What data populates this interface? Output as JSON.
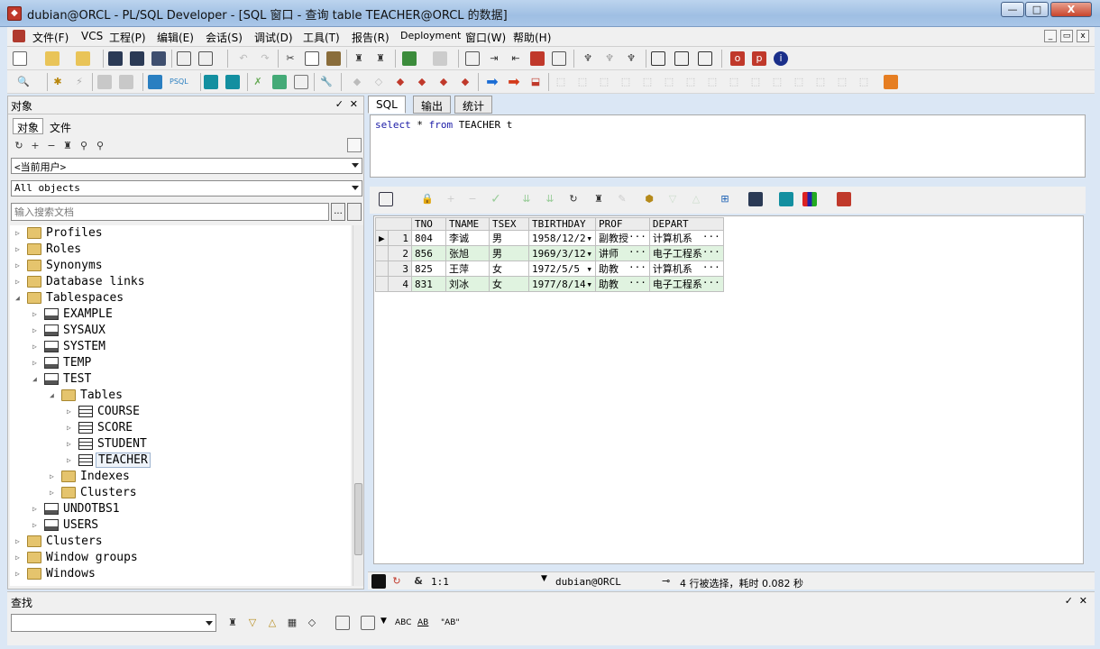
{
  "window": {
    "title": "dubian@ORCL - PL/SQL Developer - [SQL 窗口 - 查询 table TEACHER@ORCL 的数据]",
    "app_icon": "oracle-db-icon",
    "min": "—",
    "max": "□",
    "close": "X"
  },
  "menu": [
    "文件(F)",
    "VCS",
    "工程(P)",
    "编辑(E)",
    "会话(S)",
    "调试(D)",
    "工具(T)",
    "报告(R)",
    "Deployment",
    "窗口(W)",
    "帮助(H)"
  ],
  "left_panel": {
    "title": "对象",
    "pin": "✓",
    "close": "✕",
    "tabs": [
      "对象",
      "文件"
    ],
    "user_combo": "<当前用户>",
    "filter_combo": "All objects",
    "search_placeholder": "输入搜索文档",
    "search_button": "..."
  },
  "tree": [
    {
      "label": "Profiles",
      "icon": "folder"
    },
    {
      "label": "Roles",
      "icon": "folder"
    },
    {
      "label": "Synonyms",
      "icon": "folder"
    },
    {
      "label": "Database links",
      "icon": "folder"
    },
    {
      "label": "Tablespaces",
      "icon": "folder-open"
    },
    {
      "label": "EXAMPLE",
      "icon": "tablespace"
    },
    {
      "label": "SYSAUX",
      "icon": "tablespace"
    },
    {
      "label": "SYSTEM",
      "icon": "tablespace"
    },
    {
      "label": "TEMP",
      "icon": "tablespace"
    },
    {
      "label": "TEST",
      "icon": "tablespace"
    },
    {
      "label": "Tables",
      "icon": "folder-open"
    },
    {
      "label": "COURSE",
      "icon": "table"
    },
    {
      "label": "SCORE",
      "icon": "table"
    },
    {
      "label": "STUDENT",
      "icon": "table"
    },
    {
      "label": "TEACHER",
      "icon": "table",
      "selected": true
    },
    {
      "label": "Indexes",
      "icon": "folder"
    },
    {
      "label": "Clusters",
      "icon": "folder"
    },
    {
      "label": "UNDOTBS1",
      "icon": "tablespace"
    },
    {
      "label": "USERS",
      "icon": "tablespace"
    },
    {
      "label": "Clusters",
      "icon": "folder"
    },
    {
      "label": "Window groups",
      "icon": "folder"
    },
    {
      "label": "Windows",
      "icon": "folder"
    }
  ],
  "editor": {
    "tabs": [
      "SQL",
      "输出",
      "统计"
    ],
    "sql": "select * from TEACHER t"
  },
  "grid": {
    "columns": [
      "TNO",
      "TNAME",
      "TSEX",
      "TBIRTHDAY",
      "PROF",
      "DEPART"
    ],
    "rows": [
      [
        "804",
        "李诚",
        "男",
        "1958/12/2",
        "副教授",
        "计算机系"
      ],
      [
        "856",
        "张旭",
        "男",
        "1969/3/12",
        "讲师",
        "电子工程系"
      ],
      [
        "825",
        "王萍",
        "女",
        "1972/5/5",
        "助教",
        "计算机系"
      ],
      [
        "831",
        "刘冰",
        "女",
        "1977/8/14",
        "助教",
        "电子工程系"
      ]
    ]
  },
  "status": {
    "position": "1:1",
    "connection": "dubian@ORCL",
    "message": "4 行被选择，耗时 0.082 秒"
  },
  "find_panel": {
    "title": "查找",
    "pin": "✓",
    "close": "✕",
    "opt1": "ABC",
    "opt2": "AB",
    "opt3": "\"AB\""
  }
}
